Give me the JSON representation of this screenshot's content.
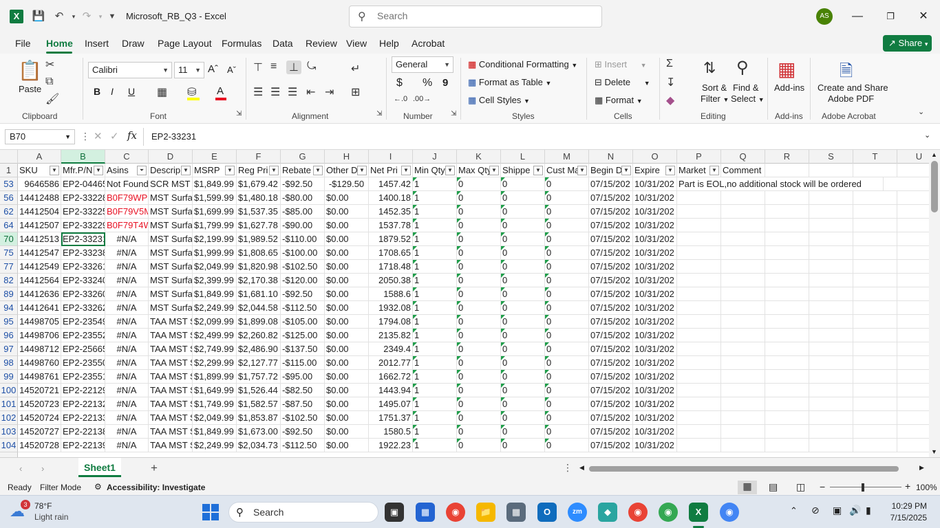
{
  "titlebar": {
    "title": "Microsoft_RB_Q3  -  Excel",
    "search_placeholder": "Search",
    "avatar": "AS"
  },
  "tabs": [
    "File",
    "Home",
    "Insert",
    "Draw",
    "Page Layout",
    "Formulas",
    "Data",
    "Review",
    "View",
    "Help",
    "Acrobat"
  ],
  "share_label": "Share",
  "ribbon": {
    "clipboard": {
      "paste": "Paste",
      "label": "Clipboard"
    },
    "font": {
      "name": "Calibri",
      "size": "11",
      "label": "Font",
      "bold": "B",
      "italic": "I",
      "underline": "U"
    },
    "alignment": {
      "label": "Alignment"
    },
    "number": {
      "format": "General",
      "label": "Number",
      "currency": "$",
      "percent": "%",
      "comma": "9"
    },
    "styles": {
      "conditional": "Conditional Formatting",
      "table": "Format as Table",
      "cell": "Cell Styles",
      "label": "Styles"
    },
    "cells": {
      "insert": "Insert",
      "delete": "Delete",
      "format": "Format",
      "label": "Cells"
    },
    "editing": {
      "sort": "Sort &",
      "sort2": "Filter",
      "find": "Find &",
      "find2": "Select",
      "label": "Editing"
    },
    "addins": {
      "btn": "Add-ins",
      "label": "Add-ins"
    },
    "acrobat": {
      "btn1": "Create and Share",
      "btn2": "Adobe PDF",
      "label": "Adobe Acrobat"
    }
  },
  "formula_bar": {
    "name_box": "B70",
    "fx": "fx",
    "value": "EP2-33231"
  },
  "columns": [
    "A",
    "B",
    "C",
    "D",
    "E",
    "F",
    "G",
    "H",
    "I",
    "J",
    "K",
    "L",
    "M",
    "N",
    "O",
    "P",
    "Q",
    "R",
    "S",
    "T",
    "U"
  ],
  "header_row": {
    "num": "1",
    "cells": [
      "SKU",
      "Mfr.P/N",
      "Asins",
      "Descrip",
      "MSRP",
      "Reg Pri",
      "Rebate",
      "Other D",
      "Net Pri",
      "Min Qty",
      "Max Qty",
      "Shippe",
      "Cust Ma",
      "Begin D",
      "Expire",
      "Market",
      "Comment"
    ]
  },
  "rows": [
    {
      "num": "53",
      "sku": "9646586",
      "pn": "EP2-04465",
      "asin": "Not Found",
      "desc": "SCR MST S",
      "msrp": "$1,849.99",
      "reg": "$1,679.42",
      "reb": "-$92.50",
      "oth": "-$129.50",
      "net": "1457.42",
      "min": "1",
      "max": "0",
      "shp": "0",
      "cust": "0",
      "begin": "07/15/202",
      "exp": "10/31/202",
      "comment": "Part is EOL,no additional stock will be ordered"
    },
    {
      "num": "56",
      "sku": "14412488",
      "pn": "EP2-33228",
      "asin": "B0F79WPL",
      "desc": "MST Surfa",
      "msrp": "$1,599.99",
      "reg": "$1,480.18",
      "reb": "-$80.00",
      "oth": "$0.00",
      "net": "1400.18",
      "min": "1",
      "max": "0",
      "shp": "0",
      "cust": "0",
      "begin": "07/15/202",
      "exp": "10/31/202",
      "comment": ""
    },
    {
      "num": "62",
      "sku": "14412504",
      "pn": "EP2-33225",
      "asin": "B0F79V5M",
      "desc": "MST Surfa",
      "msrp": "$1,699.99",
      "reg": "$1,537.35",
      "reb": "-$85.00",
      "oth": "$0.00",
      "net": "1452.35",
      "min": "1",
      "max": "0",
      "shp": "0",
      "cust": "0",
      "begin": "07/15/202",
      "exp": "10/31/202",
      "comment": ""
    },
    {
      "num": "64",
      "sku": "14412507",
      "pn": "EP2-33229",
      "asin": "B0F79T4W",
      "desc": "MST Surfa",
      "msrp": "$1,799.99",
      "reg": "$1,627.78",
      "reb": "-$90.00",
      "oth": "$0.00",
      "net": "1537.78",
      "min": "1",
      "max": "0",
      "shp": "0",
      "cust": "0",
      "begin": "07/15/202",
      "exp": "10/31/202",
      "comment": ""
    },
    {
      "num": "70",
      "sku": "14412513",
      "pn": "EP2-33231",
      "asin": "#N/A",
      "desc": "MST Surfa",
      "msrp": "$2,199.99",
      "reg": "$1,989.52",
      "reb": "-$110.00",
      "oth": "$0.00",
      "net": "1879.52",
      "min": "1",
      "max": "0",
      "shp": "0",
      "cust": "0",
      "begin": "07/15/202",
      "exp": "10/31/202",
      "comment": ""
    },
    {
      "num": "75",
      "sku": "14412547",
      "pn": "EP2-33238",
      "asin": "#N/A",
      "desc": "MST Surfa",
      "msrp": "$1,999.99",
      "reg": "$1,808.65",
      "reb": "-$100.00",
      "oth": "$0.00",
      "net": "1708.65",
      "min": "1",
      "max": "0",
      "shp": "0",
      "cust": "0",
      "begin": "07/15/202",
      "exp": "10/31/202",
      "comment": ""
    },
    {
      "num": "77",
      "sku": "14412549",
      "pn": "EP2-33261",
      "asin": "#N/A",
      "desc": "MST Surfa",
      "msrp": "$2,049.99",
      "reg": "$1,820.98",
      "reb": "-$102.50",
      "oth": "$0.00",
      "net": "1718.48",
      "min": "1",
      "max": "0",
      "shp": "0",
      "cust": "0",
      "begin": "07/15/202",
      "exp": "10/31/202",
      "comment": ""
    },
    {
      "num": "82",
      "sku": "14412564",
      "pn": "EP2-33240",
      "asin": "#N/A",
      "desc": "MST Surfa",
      "msrp": "$2,399.99",
      "reg": "$2,170.38",
      "reb": "-$120.00",
      "oth": "$0.00",
      "net": "2050.38",
      "min": "1",
      "max": "0",
      "shp": "0",
      "cust": "0",
      "begin": "07/15/202",
      "exp": "10/31/202",
      "comment": ""
    },
    {
      "num": "89",
      "sku": "14412636",
      "pn": "EP2-33260",
      "asin": "#N/A",
      "desc": "MST Surfa",
      "msrp": "$1,849.99",
      "reg": "$1,681.10",
      "reb": "-$92.50",
      "oth": "$0.00",
      "net": "1588.6",
      "min": "1",
      "max": "0",
      "shp": "0",
      "cust": "0",
      "begin": "07/15/202",
      "exp": "10/31/202",
      "comment": ""
    },
    {
      "num": "94",
      "sku": "14412641",
      "pn": "EP2-33262",
      "asin": "#N/A",
      "desc": "MST Surfa",
      "msrp": "$2,249.99",
      "reg": "$2,044.58",
      "reb": "-$112.50",
      "oth": "$0.00",
      "net": "1932.08",
      "min": "1",
      "max": "0",
      "shp": "0",
      "cust": "0",
      "begin": "07/15/202",
      "exp": "10/31/202",
      "comment": ""
    },
    {
      "num": "95",
      "sku": "14498705",
      "pn": "EP2-23549",
      "asin": "#N/A",
      "desc": "TAA MST S",
      "msrp": "$2,099.99",
      "reg": "$1,899.08",
      "reb": "-$105.00",
      "oth": "$0.00",
      "net": "1794.08",
      "min": "1",
      "max": "0",
      "shp": "0",
      "cust": "0",
      "begin": "07/15/202",
      "exp": "10/31/202",
      "comment": ""
    },
    {
      "num": "96",
      "sku": "14498706",
      "pn": "EP2-23552",
      "asin": "#N/A",
      "desc": "TAA MST S",
      "msrp": "$2,499.99",
      "reg": "$2,260.82",
      "reb": "-$125.00",
      "oth": "$0.00",
      "net": "2135.82",
      "min": "1",
      "max": "0",
      "shp": "0",
      "cust": "0",
      "begin": "07/15/202",
      "exp": "10/31/202",
      "comment": ""
    },
    {
      "num": "97",
      "sku": "14498712",
      "pn": "EP2-25665",
      "asin": "#N/A",
      "desc": "TAA MST S",
      "msrp": "$2,749.99",
      "reg": "$2,486.90",
      "reb": "-$137.50",
      "oth": "$0.00",
      "net": "2349.4",
      "min": "1",
      "max": "0",
      "shp": "0",
      "cust": "0",
      "begin": "07/15/202",
      "exp": "10/31/202",
      "comment": ""
    },
    {
      "num": "98",
      "sku": "14498760",
      "pn": "EP2-23550",
      "asin": "#N/A",
      "desc": "TAA MST S",
      "msrp": "$2,299.99",
      "reg": "$2,127.77",
      "reb": "-$115.00",
      "oth": "$0.00",
      "net": "2012.77",
      "min": "1",
      "max": "0",
      "shp": "0",
      "cust": "0",
      "begin": "07/15/202",
      "exp": "10/31/202",
      "comment": ""
    },
    {
      "num": "99",
      "sku": "14498761",
      "pn": "EP2-23551",
      "asin": "#N/A",
      "desc": "TAA MST S",
      "msrp": "$1,899.99",
      "reg": "$1,757.72",
      "reb": "-$95.00",
      "oth": "$0.00",
      "net": "1662.72",
      "min": "1",
      "max": "0",
      "shp": "0",
      "cust": "0",
      "begin": "07/15/202",
      "exp": "10/31/202",
      "comment": ""
    },
    {
      "num": "100",
      "sku": "14520721",
      "pn": "EP2-22129",
      "asin": "#N/A",
      "desc": "TAA MST S",
      "msrp": "$1,649.99",
      "reg": "$1,526.44",
      "reb": "-$82.50",
      "oth": "$0.00",
      "net": "1443.94",
      "min": "1",
      "max": "0",
      "shp": "0",
      "cust": "0",
      "begin": "07/15/202",
      "exp": "10/31/202",
      "comment": ""
    },
    {
      "num": "101",
      "sku": "14520723",
      "pn": "EP2-22132",
      "asin": "#N/A",
      "desc": "TAA MST S",
      "msrp": "$1,749.99",
      "reg": "$1,582.57",
      "reb": "-$87.50",
      "oth": "$0.00",
      "net": "1495.07",
      "min": "1",
      "max": "0",
      "shp": "0",
      "cust": "0",
      "begin": "07/15/202",
      "exp": "10/31/202",
      "comment": ""
    },
    {
      "num": "102",
      "sku": "14520724",
      "pn": "EP2-22133",
      "asin": "#N/A",
      "desc": "TAA MST S",
      "msrp": "$2,049.99",
      "reg": "$1,853.87",
      "reb": "-$102.50",
      "oth": "$0.00",
      "net": "1751.37",
      "min": "1",
      "max": "0",
      "shp": "0",
      "cust": "0",
      "begin": "07/15/202",
      "exp": "10/31/202",
      "comment": ""
    },
    {
      "num": "103",
      "sku": "14520727",
      "pn": "EP2-22138",
      "asin": "#N/A",
      "desc": "TAA MST S",
      "msrp": "$1,849.99",
      "reg": "$1,673.00",
      "reb": "-$92.50",
      "oth": "$0.00",
      "net": "1580.5",
      "min": "1",
      "max": "0",
      "shp": "0",
      "cust": "0",
      "begin": "07/15/202",
      "exp": "10/31/202",
      "comment": ""
    },
    {
      "num": "104",
      "sku": "14520728",
      "pn": "EP2-22139",
      "asin": "#N/A",
      "desc": "TAA MST S",
      "msrp": "$2,249.99",
      "reg": "$2,034.73",
      "reb": "-$112.50",
      "oth": "$0.00",
      "net": "1922.23",
      "min": "1",
      "max": "0",
      "shp": "0",
      "cust": "0",
      "begin": "07/15/202",
      "exp": "10/31/202",
      "comment": ""
    }
  ],
  "sheet": {
    "name": "Sheet1",
    "add": "+"
  },
  "status": {
    "ready": "Ready",
    "filter": "Filter Mode",
    "accessibility": "Accessibility: Investigate",
    "zoom": "100%"
  },
  "taskbar": {
    "weather_temp": "78°F",
    "weather_desc": "Light rain",
    "weather_badge": "3",
    "search": "Search",
    "time": "10:29 PM",
    "date": "7/15/2025"
  }
}
